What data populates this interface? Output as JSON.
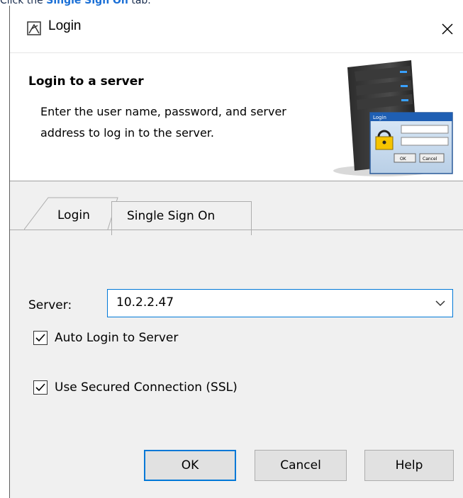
{
  "caption": {
    "prefix": "Click the ",
    "link": "Single Sign On",
    "suffix": " tab."
  },
  "window": {
    "title": "Login",
    "close_glyph": "✕"
  },
  "header": {
    "title": "Login to a server",
    "description": "Enter the user name, password, and server address to log in to the server.",
    "image_icon": "server-login-illustration-icon",
    "art_text": {
      "dialog_title": "Login",
      "ok": "OK",
      "cancel": "Cancel"
    }
  },
  "tabs": [
    {
      "label": "Login",
      "active": false
    },
    {
      "label": "Single Sign On",
      "active": true
    }
  ],
  "form": {
    "server_label": "Server:",
    "server_value": "10.2.2.47",
    "auto_login": {
      "label": "Auto Login to Server",
      "checked": true
    },
    "ssl": {
      "label": "Use Secured Connection (SSL)",
      "checked": true
    }
  },
  "buttons": {
    "ok": "OK",
    "cancel": "Cancel",
    "help": "Help"
  },
  "colors": {
    "accent": "#0078d7",
    "link": "#1a6fd6",
    "window_bg": "#f0f0f0"
  }
}
